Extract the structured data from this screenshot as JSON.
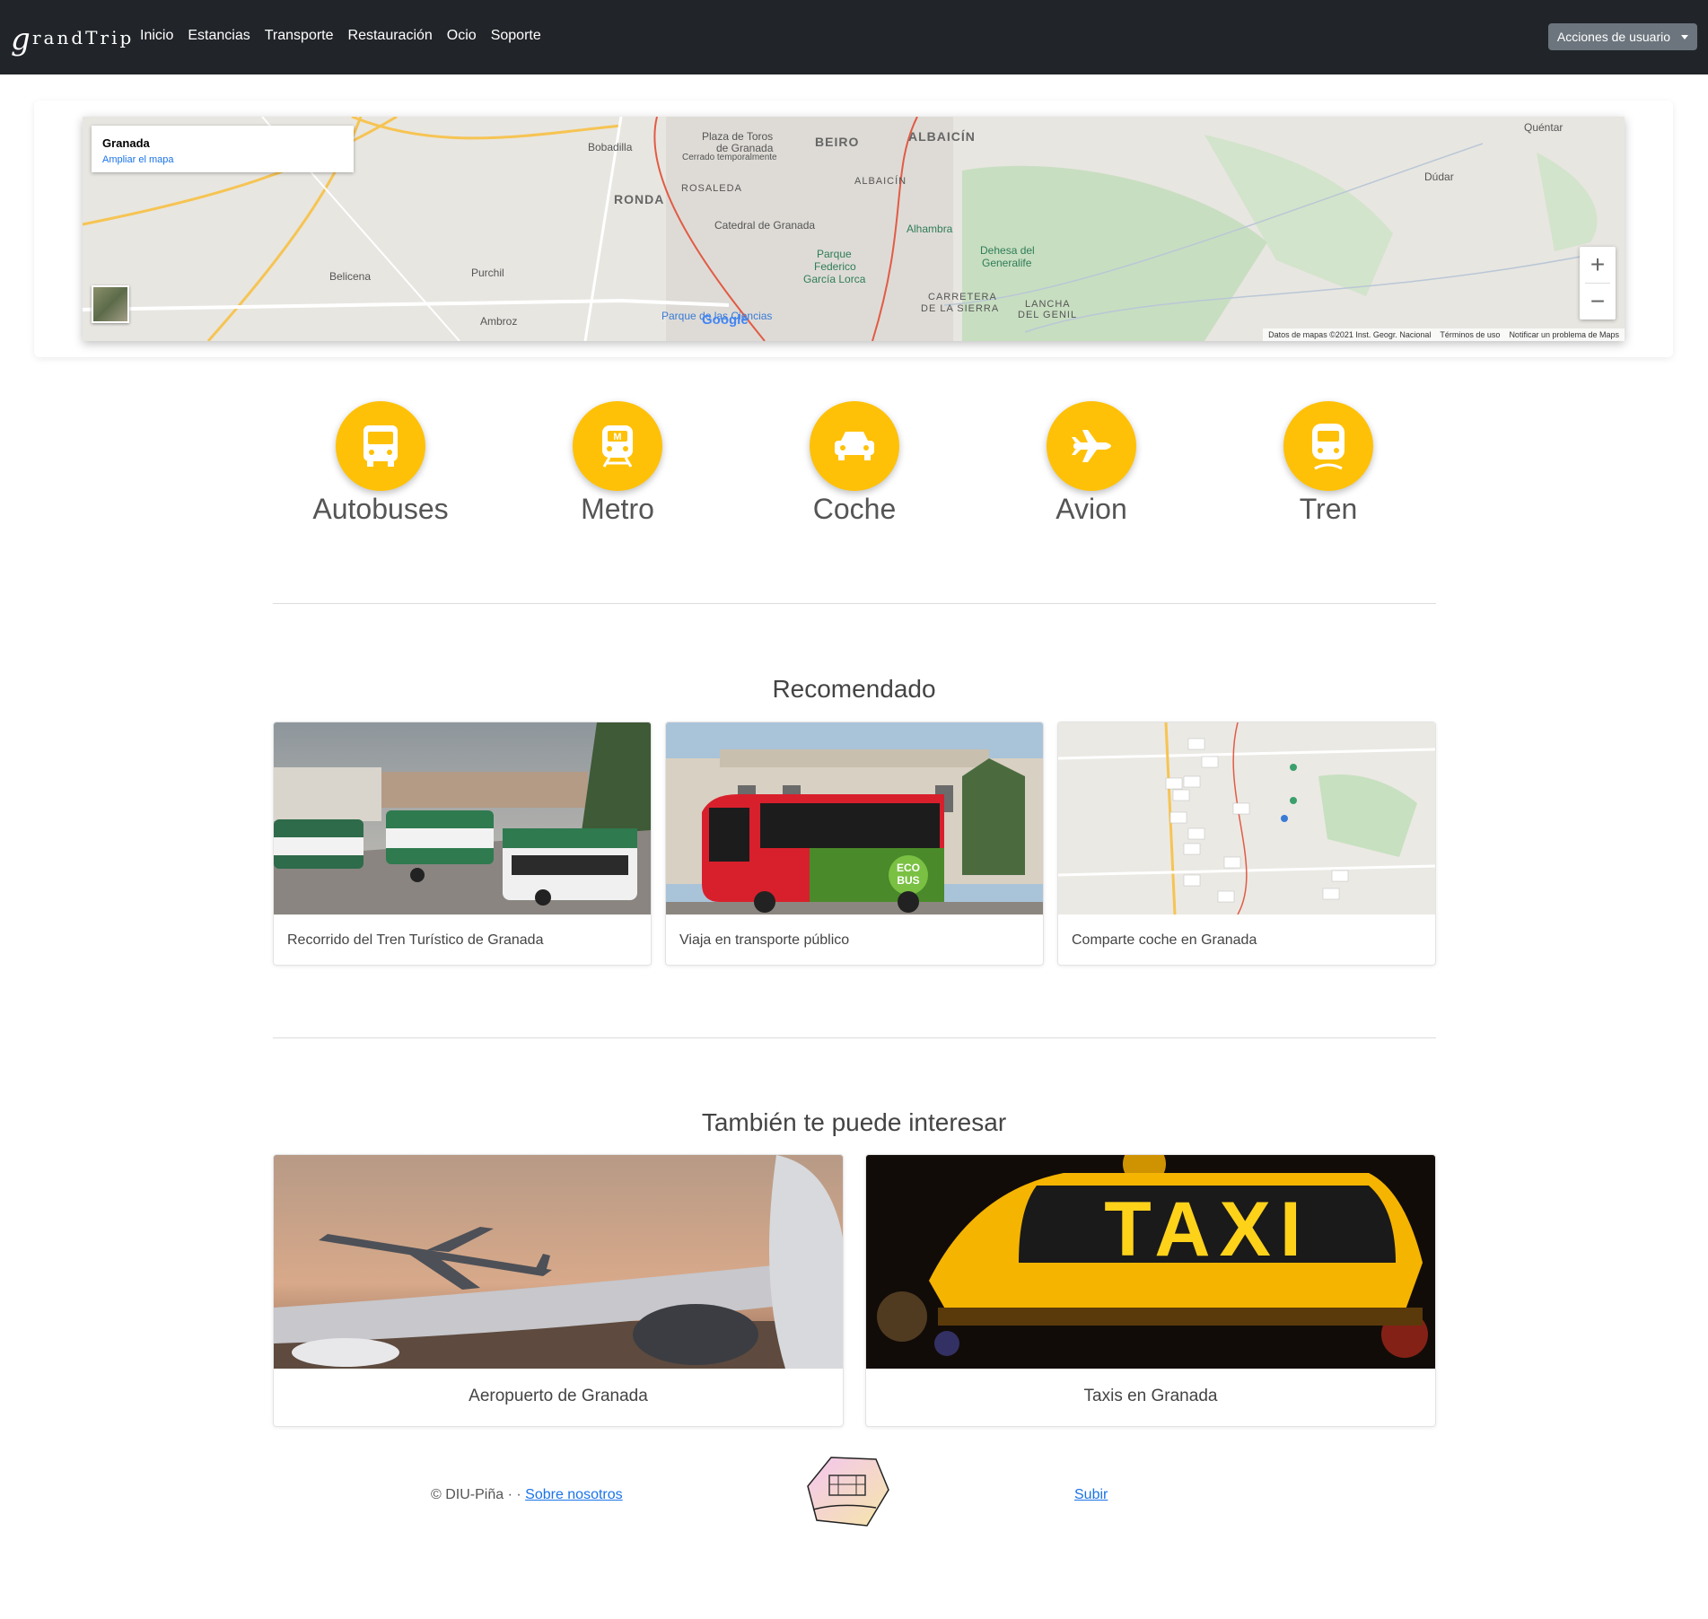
{
  "nav": {
    "brand": "grandTrip",
    "links": [
      "Inicio",
      "Estancias",
      "Transporte",
      "Restauración",
      "Ocio",
      "Soporte"
    ],
    "user_actions": "Acciones de usuario"
  },
  "map": {
    "place": "Granada",
    "enlarge_link": "Ampliar el mapa",
    "zoom_in": "+",
    "zoom_out": "−",
    "attribution": [
      "Datos de mapas ©2021 Inst. Geogr. Nacional",
      "Términos de uso",
      "Notificar un problema de Maps"
    ],
    "google": "Google",
    "labels": {
      "bobadilla": "Bobadilla",
      "plaza": "Plaza de Toros",
      "plaza2": "de Granada",
      "cerrado": "Cerrado temporalmente",
      "beiro": "BEIRO",
      "albaicin": "ALBAICÍN",
      "albaicin2": "ALBAICÍN",
      "quentar": "Quéntar",
      "dudar": "Dúdar",
      "ronda": "RONDA",
      "rosaleda": "ROSALEDA",
      "catedral": "Catedral de Granada",
      "alhambra": "Alhambra",
      "dehesa": "Dehesa del",
      "dehesa2": "Generalife",
      "parque": "Parque",
      "parque2": "Federico",
      "parque3": "García Lorca",
      "belicena": "Belicena",
      "purchil": "Purchil",
      "ambroz": "Ambroz",
      "ciencias": "Parque de las Ciencias",
      "carretera": "CARRETERA",
      "carretera2": "DE LA SIERRA",
      "lancha": "LANCHA",
      "lancha2": "DEL GENIL"
    }
  },
  "transport": [
    "Autobuses",
    "Metro",
    "Coche",
    "Avion",
    "Tren"
  ],
  "recommended": {
    "title": "Recomendado",
    "cards": [
      "Recorrido del Tren Turístico de Granada",
      "Viaja en transporte público",
      "Comparte coche en Granada"
    ]
  },
  "interest": {
    "title": "También te puede interesar",
    "cards": [
      "Aeropuerto de Granada",
      "Taxis en Granada"
    ],
    "taxi_sign": "TAXI"
  },
  "footer": {
    "copyright": "© DIU-Piña · ·",
    "about": "Sobre nosotros",
    "up": "Subir"
  },
  "colors": {
    "accent": "#ffc107",
    "navbar": "#212529",
    "link": "#1a73e8"
  }
}
